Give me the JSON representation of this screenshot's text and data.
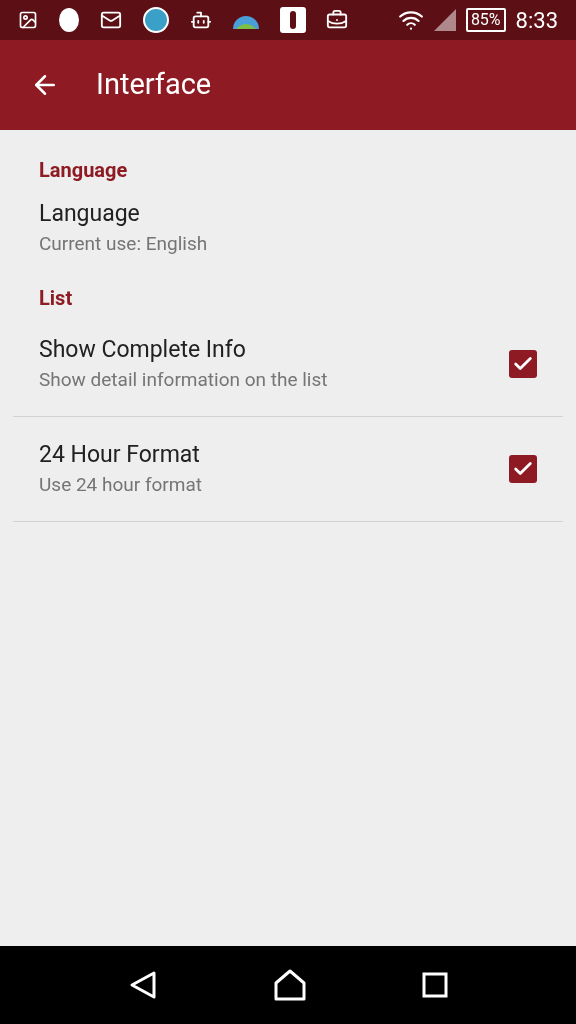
{
  "status_bar": {
    "battery": "85%",
    "time": "8:33"
  },
  "app_bar": {
    "title": "Interface"
  },
  "sections": [
    {
      "header": "Language",
      "items": [
        {
          "kind": "plain",
          "title": "Language",
          "summary": "Current use: English"
        }
      ]
    },
    {
      "header": "List",
      "items": [
        {
          "kind": "checkbox",
          "title": "Show Complete Info",
          "summary": "Show detail information on the list",
          "checked": true
        },
        {
          "kind": "checkbox",
          "title": "24 Hour Format",
          "summary": "Use 24 hour format",
          "checked": true
        }
      ]
    }
  ]
}
